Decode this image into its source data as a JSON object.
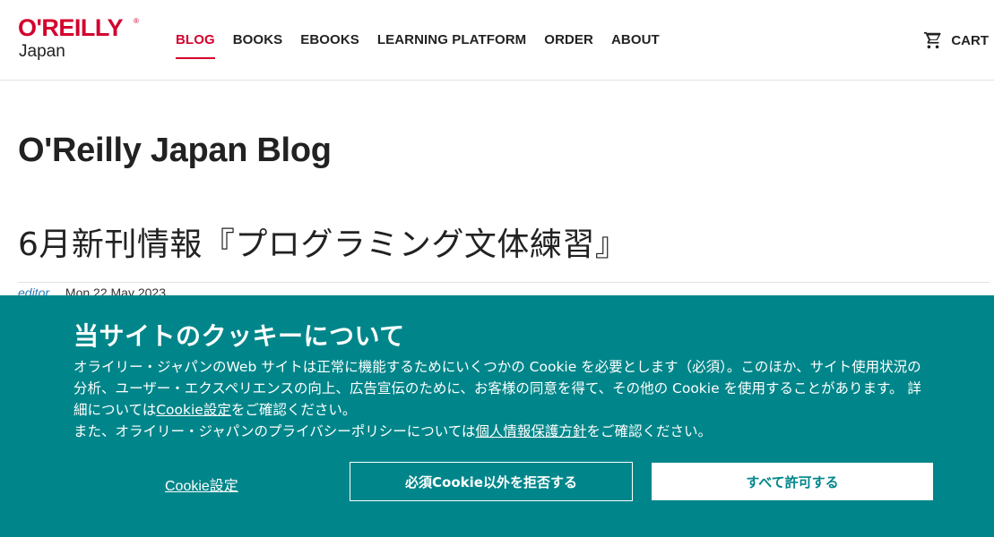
{
  "header": {
    "logo": {
      "main": "O'REILLY",
      "registered": "®",
      "sub": "Japan"
    },
    "nav": [
      {
        "label": "BLOG",
        "active": true
      },
      {
        "label": "BOOKS",
        "active": false
      },
      {
        "label": "EBOOKS",
        "active": false
      },
      {
        "label": "LEARNING PLATFORM",
        "active": false
      },
      {
        "label": "ORDER",
        "active": false
      },
      {
        "label": "ABOUT",
        "active": false
      }
    ],
    "cart": {
      "icon": "cart-icon",
      "label": "CART"
    }
  },
  "main": {
    "blog_title": "O'Reilly Japan Blog",
    "post": {
      "title": "6月新刊情報『プログラミング文体練習』",
      "author": "editor",
      "date": "Mon 22 May 2023"
    }
  },
  "cookie_banner": {
    "title": "当サイトのクッキーについて",
    "text_line1": "オライリー・ジャパンのWeb サイトは正常に機能するためにいくつかの Cookie を必要とします（必須）。このほか、サイト使用状況の分析、ユーザー・エクスペリエンスの向上、広告宣伝のために、お客様の同意を得て、その他の Cookie を使用することがあります。 詳細については",
    "link_cookie_settings": "Cookie設定",
    "text_line1_end": "をご確認ください。",
    "text_line2": "また、オライリー・ジャパンのプライバシーポリシーについては",
    "link_privacy": "個人情報保護方針",
    "text_line2_end": "をご確認ください。",
    "settings_button": "Cookie設定",
    "reject_button": "必須Cookie以外を拒否する",
    "accept_button": "すべて許可する"
  },
  "colors": {
    "brand_red": "#d3002d",
    "banner_teal": "#00868a",
    "text": "#222222",
    "author_link": "#2a7ab8"
  }
}
